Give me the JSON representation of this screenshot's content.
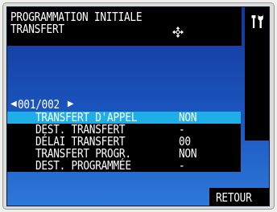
{
  "header": {
    "title": "PROGRAMMATION INITIALE",
    "subtitle": "TRANSFERT",
    "move_icon": "four-way-arrow-icon",
    "tools_icon": "tools-icon"
  },
  "pager": {
    "prev_icon": "triangle-left-icon",
    "text": "001/002",
    "next_icon": "triangle-right-icon"
  },
  "items": [
    {
      "label": "TRANSFERT D'APPEL",
      "value": "NON",
      "selected": true
    },
    {
      "label": "DEST. TRANSFERT",
      "value": "-"
    },
    {
      "label": "DÉLAI TRANSFERT",
      "value": "00"
    },
    {
      "label": "TRANSFERT PROGR.",
      "value": "NON"
    },
    {
      "label": "DEST. PROGRAMMÉE",
      "value": "-"
    }
  ],
  "footer": {
    "back_label": "RETOUR"
  },
  "colors": {
    "background_top": "#12379a",
    "background_bottom": "#2d78d8",
    "selected_row": "#1eaee8",
    "text": "#ffffff",
    "bar": "#000000"
  }
}
